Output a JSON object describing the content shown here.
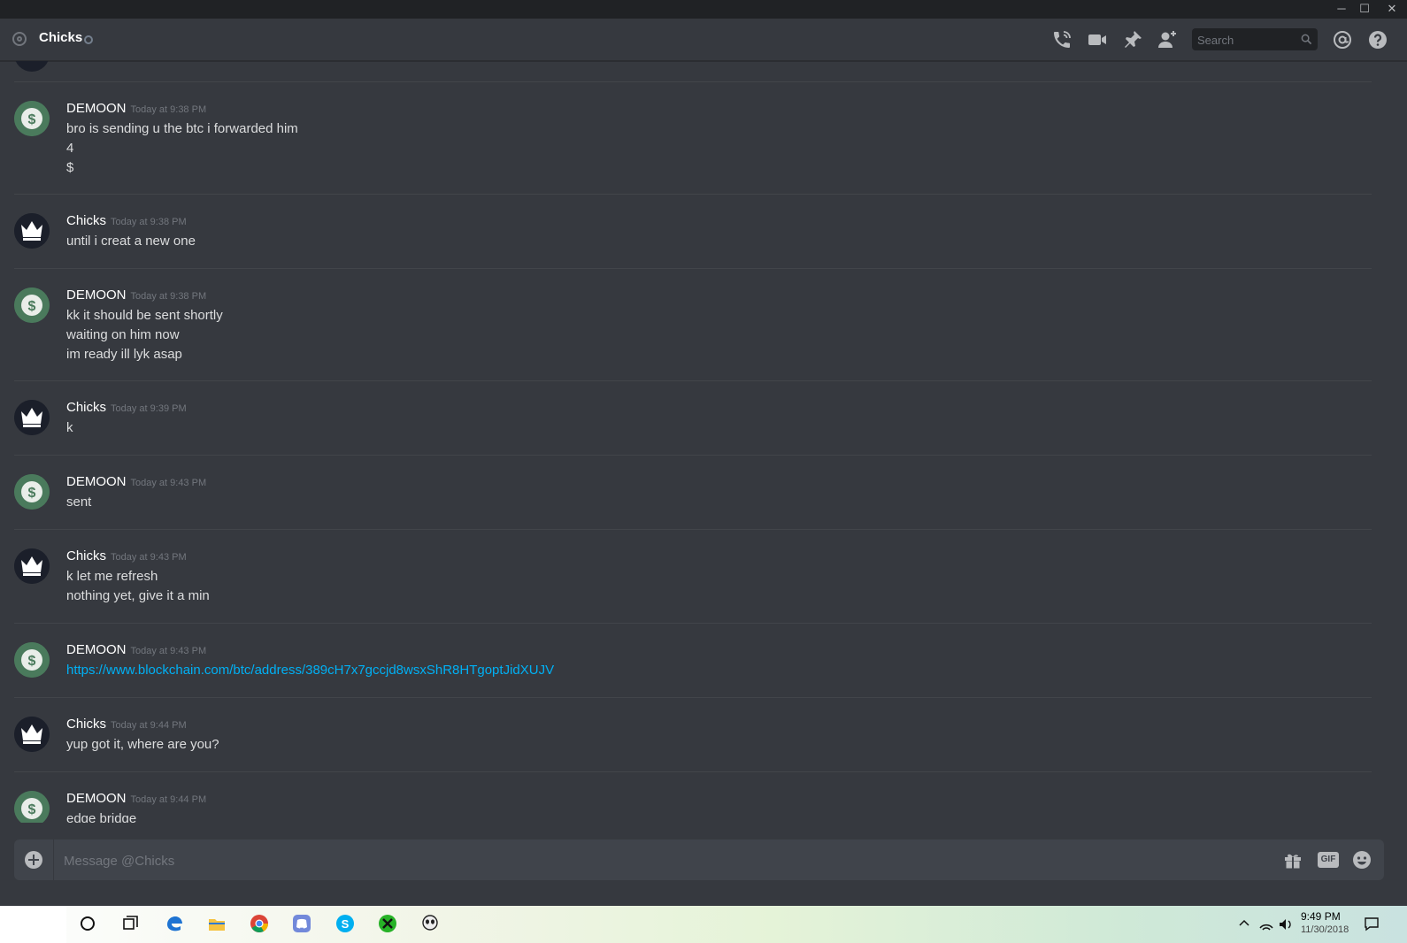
{
  "window": {
    "minimize": "─",
    "maximize": "☐",
    "close": "✕"
  },
  "header": {
    "channel_name": "Chicks",
    "search_placeholder": "Search",
    "icons": [
      "phone-call-icon",
      "video-icon",
      "pin-icon",
      "add-friend-icon",
      "mention-icon",
      "help-icon"
    ]
  },
  "messages": [
    {
      "author": "DEMOON",
      "avatar": "dollar",
      "timestamp": "Today at 9:38 PM",
      "lines": [
        "bro is sending u the btc i forwarded him",
        "4",
        "$"
      ]
    },
    {
      "author": "Chicks",
      "avatar": "crown",
      "timestamp": "Today at 9:38 PM",
      "lines": [
        "until i creat a new one"
      ]
    },
    {
      "author": "DEMOON",
      "avatar": "dollar",
      "timestamp": "Today at 9:38 PM",
      "lines": [
        "kk it should be sent shortly",
        "waiting on him now",
        "im ready ill lyk asap"
      ]
    },
    {
      "author": "Chicks",
      "avatar": "crown",
      "timestamp": "Today at 9:39 PM",
      "lines": [
        "k"
      ]
    },
    {
      "author": "DEMOON",
      "avatar": "dollar",
      "timestamp": "Today at 9:43 PM",
      "lines": [
        "sent"
      ]
    },
    {
      "author": "Chicks",
      "avatar": "crown",
      "timestamp": "Today at 9:43 PM",
      "lines": [
        "k let me refresh",
        "nothing yet, give it a min"
      ]
    },
    {
      "author": "DEMOON",
      "avatar": "dollar",
      "timestamp": "Today at 9:43 PM",
      "lines": [
        "https://www.blockchain.com/btc/address/389cH7x7gccjd8wsxShR8HTgoptJidXUJV"
      ],
      "link": true
    },
    {
      "author": "Chicks",
      "avatar": "crown",
      "timestamp": "Today at 9:44 PM",
      "lines": [
        "yup got it, where are you?"
      ]
    },
    {
      "author": "DEMOON",
      "avatar": "dollar",
      "timestamp": "Today at 9:44 PM",
      "lines": [
        "edge bridge"
      ]
    }
  ],
  "composer": {
    "placeholder": "Message @Chicks",
    "gif_label": "GIF"
  },
  "taskbar": {
    "time": "9:49 PM",
    "date": "11/30/2018",
    "apps": [
      "cortana-search-icon",
      "task-view-icon",
      "edge-icon",
      "file-explorer-icon",
      "chrome-icon",
      "discord-icon",
      "skype-icon",
      "xbox-icon",
      "alien-app-icon"
    ]
  },
  "colors": {
    "background": "#36393f",
    "link": "#00b0f4",
    "username": "#ffffff",
    "timestamp": "#72767d"
  }
}
